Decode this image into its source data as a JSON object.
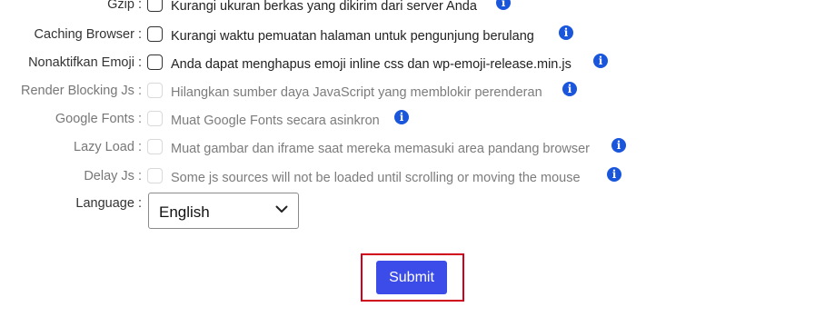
{
  "options": [
    {
      "label": "Gzip :",
      "description": "Kurangi ukuran berkas yang dikirim dari server Anda",
      "enabled": true,
      "info_icon": "info-icon"
    },
    {
      "label": "Caching Browser :",
      "description": "Kurangi waktu pemuatan halaman untuk pengunjung berulang",
      "enabled": true,
      "info_icon": "info-icon"
    },
    {
      "label": "Nonaktifkan Emoji :",
      "description": "Anda dapat menghapus emoji inline css dan wp-emoji-release.min.js",
      "enabled": true,
      "info_icon": "info-icon"
    },
    {
      "label": "Render Blocking Js :",
      "description": "Hilangkan sumber daya JavaScript yang memblokir perenderan",
      "enabled": false,
      "info_icon": "info-icon"
    },
    {
      "label": "Google Fonts :",
      "description": "Muat Google Fonts secara asinkron",
      "enabled": false,
      "info_icon": "info-icon"
    },
    {
      "label": "Lazy Load :",
      "description": "Muat gambar dan iframe saat mereka memasuki area pandang browser",
      "enabled": false,
      "info_icon": "info-icon"
    },
    {
      "label": "Delay Js :",
      "description": "Some js sources will not be loaded until scrolling or moving the mouse",
      "enabled": false,
      "info_icon": "info-icon"
    }
  ],
  "language": {
    "label": "Language :",
    "selected": "English",
    "icon": "chevron-down-icon"
  },
  "submit": {
    "label": "Submit",
    "color": "#3b4ce8",
    "highlight_color": "#d0021b"
  }
}
